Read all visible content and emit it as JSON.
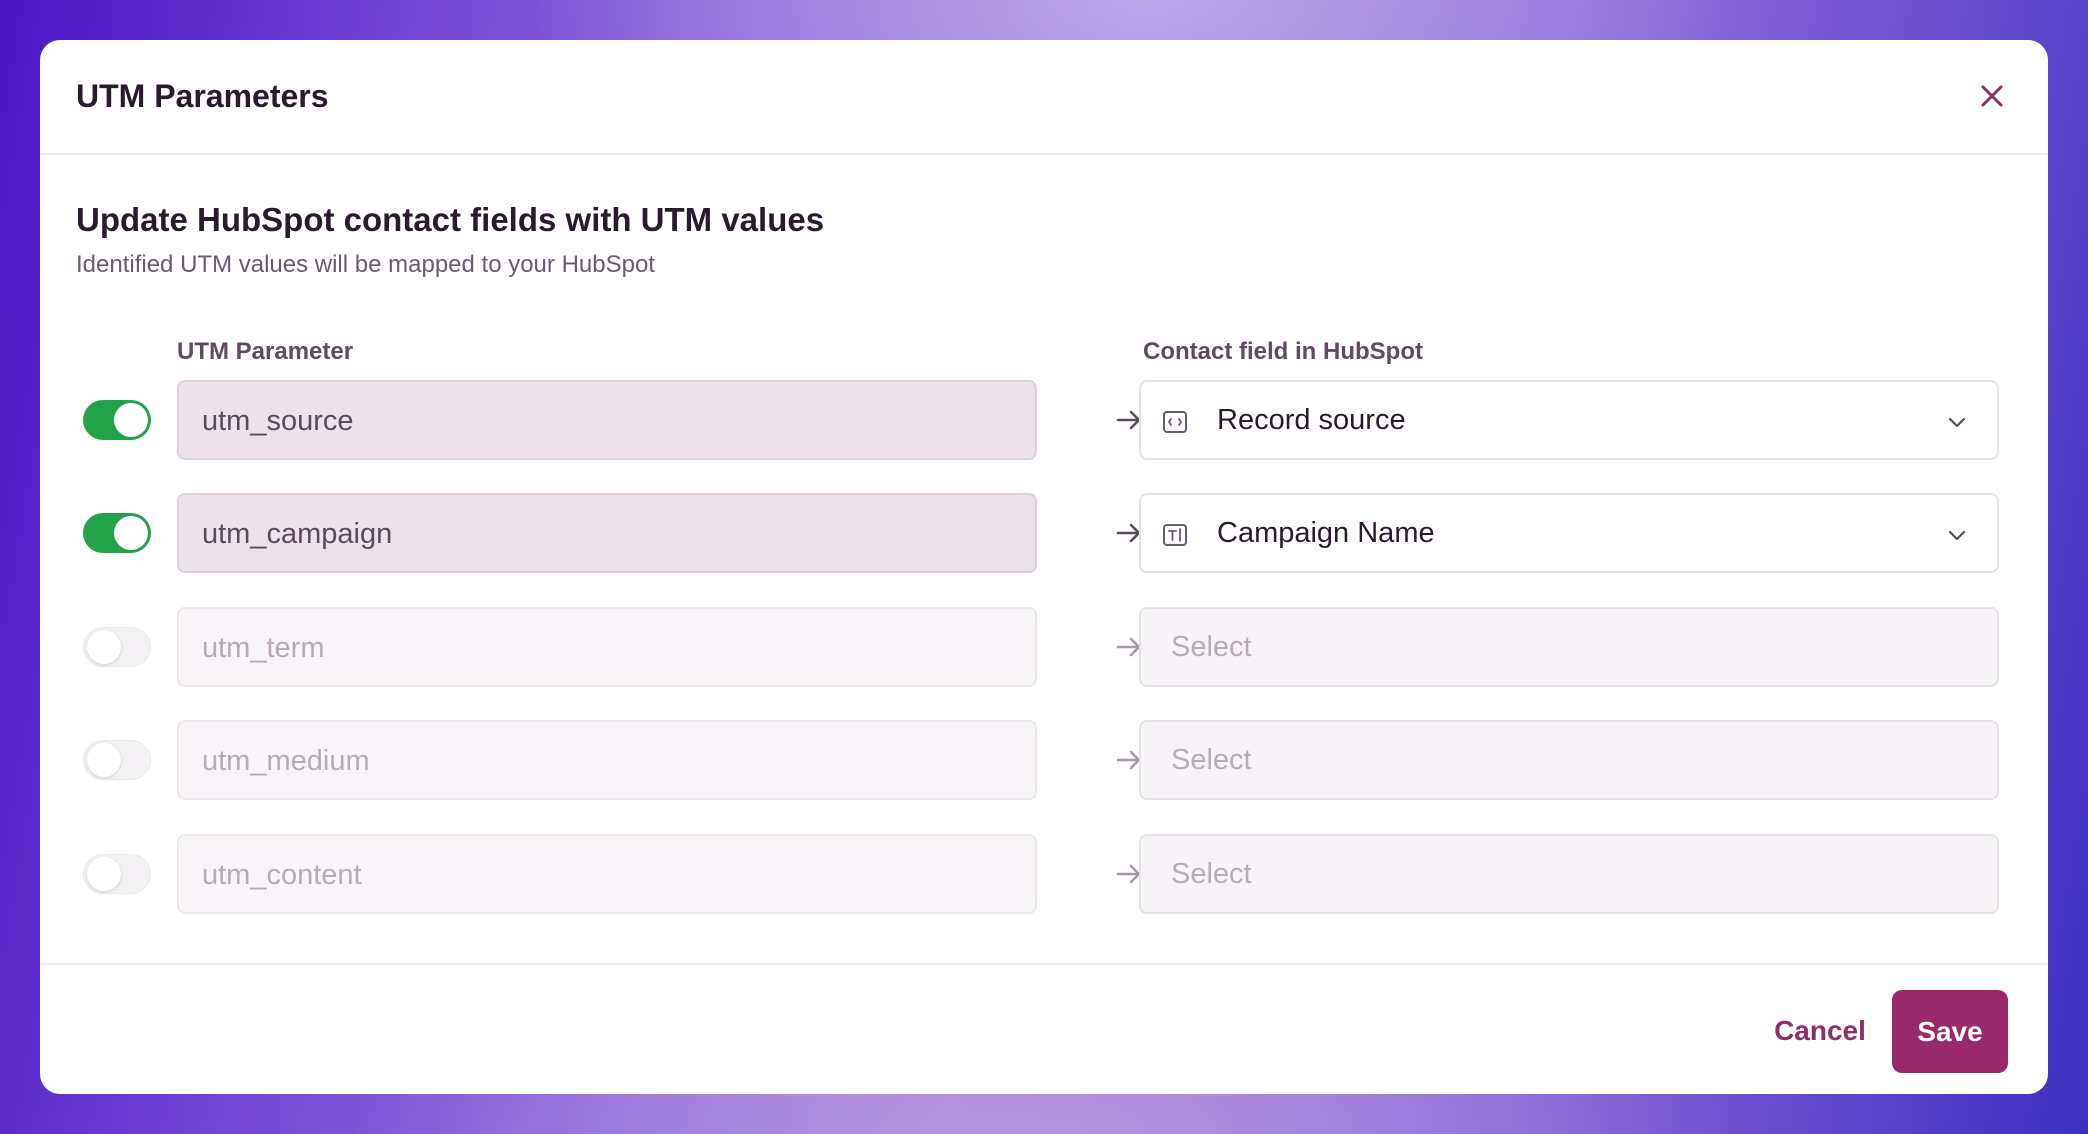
{
  "modal": {
    "title": "UTM Parameters"
  },
  "section": {
    "title": "Update HubSpot contact fields with UTM values",
    "subtitle": "Identified UTM values will be mapped to your HubSpot"
  },
  "columns": {
    "utm_parameter": "UTM Parameter",
    "contact_field": "Contact field in HubSpot"
  },
  "mappings": [
    {
      "enabled": true,
      "param": "utm_source",
      "field": "Record source",
      "field_icon": "calendar-field-icon"
    },
    {
      "enabled": true,
      "param": "utm_campaign",
      "field": "Campaign Name",
      "field_icon": "text-field-icon"
    },
    {
      "enabled": false,
      "param": "utm_term",
      "field": "Select"
    },
    {
      "enabled": false,
      "param": "utm_medium",
      "field": "Select"
    },
    {
      "enabled": false,
      "param": "utm_content",
      "field": "Select"
    }
  ],
  "footer": {
    "cancel_label": "Cancel",
    "save_label": "Save"
  },
  "colors": {
    "brand": "#98296a",
    "toggle_on": "#22a34a",
    "title_text": "#2a1a2e"
  }
}
